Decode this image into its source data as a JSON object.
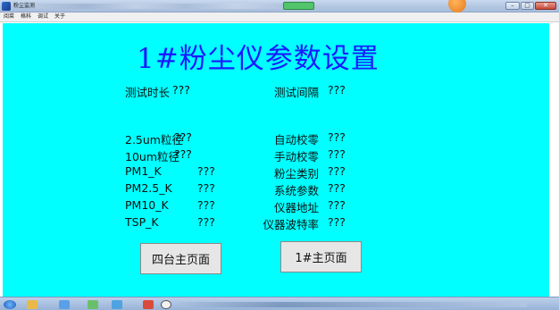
{
  "window": {
    "title": "粉尘监测",
    "close_glyph": "✕",
    "min_glyph": "–",
    "max_glyph": "▢"
  },
  "menu": {
    "items": [
      "阅菜",
      "格科",
      "调试",
      "关于"
    ]
  },
  "page": {
    "title": "1#粉尘仪参数设置"
  },
  "params": {
    "left": [
      {
        "label": "测试时长",
        "value": "???"
      },
      {
        "label": "2.5um粒径",
        "value": "???"
      },
      {
        "label": "10um粒径",
        "value": "???"
      },
      {
        "label": "PM1_K",
        "value": "???"
      },
      {
        "label": "PM2.5_K",
        "value": "???"
      },
      {
        "label": "PM10_K",
        "value": "???"
      },
      {
        "label": "TSP_K",
        "value": "???"
      }
    ],
    "right": [
      {
        "label": "测试间隔",
        "value": "???"
      },
      {
        "label": "自动校零",
        "value": "???"
      },
      {
        "label": "手动校零",
        "value": "???"
      },
      {
        "label": "粉尘类别",
        "value": "???"
      },
      {
        "label": "系统参数",
        "value": "???"
      },
      {
        "label": "仪器地址",
        "value": "???"
      },
      {
        "label": "仪器波特率",
        "value": "???"
      }
    ]
  },
  "buttons": {
    "four_main": "四台主页面",
    "main_1": "1#主页面"
  },
  "colors": {
    "background": "#00ffff",
    "title": "#1a1aff",
    "button": "#e6e6e6"
  }
}
